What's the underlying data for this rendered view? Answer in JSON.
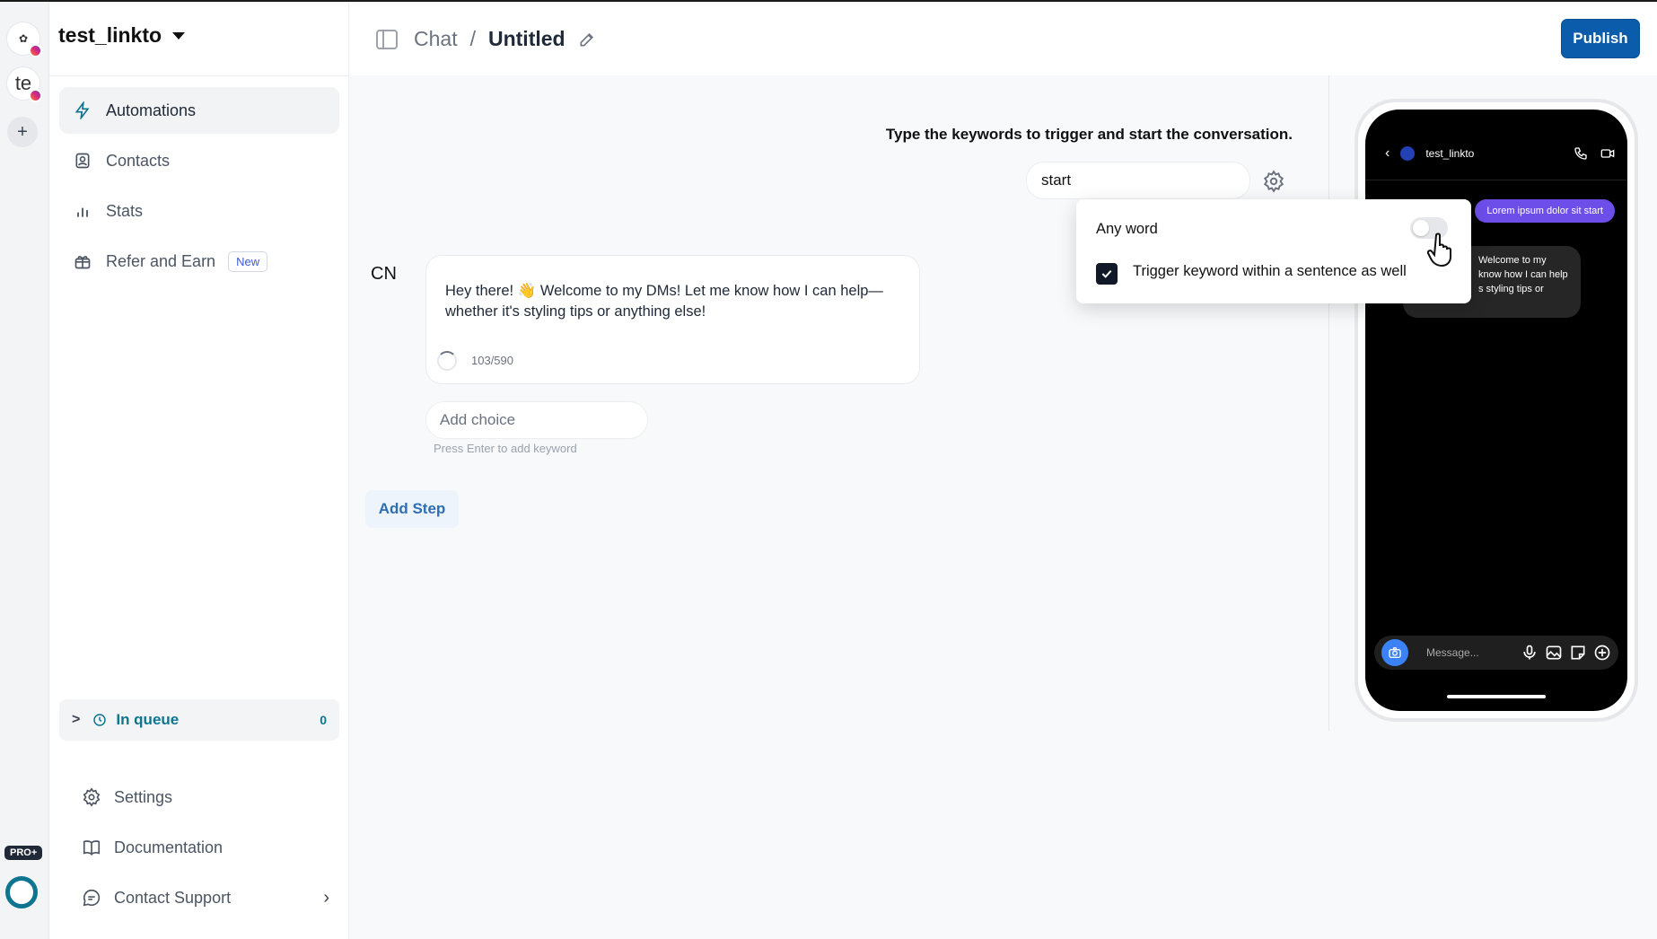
{
  "rail": {
    "add_label": "+",
    "second_account_initials": "te",
    "pro_badge": "PRO+"
  },
  "sidebar": {
    "account_name": "test_linkto",
    "nav": [
      {
        "label": "Automations",
        "icon": "bolt-icon",
        "active": true
      },
      {
        "label": "Contacts",
        "icon": "contact-card-icon"
      },
      {
        "label": "Stats",
        "icon": "bar-chart-icon"
      },
      {
        "label": "Refer and Earn",
        "icon": "gift-icon",
        "badge": "New"
      }
    ],
    "queue": {
      "label": "In queue",
      "count": "0"
    },
    "bottom": [
      {
        "label": "Settings",
        "icon": "gear-icon"
      },
      {
        "label": "Documentation",
        "icon": "book-icon"
      },
      {
        "label": "Contact Support",
        "icon": "support-chat-icon"
      }
    ]
  },
  "header": {
    "crumb_root": "Chat",
    "separator": "/",
    "title": "Untitled",
    "publish_label": "Publish",
    "publish_color": "#0b5cab"
  },
  "canvas": {
    "trigger_instruction": "Type the keywords to trigger and start the conversation.",
    "keyword_value": "start",
    "sender_initials": "CN",
    "message_text": "Hey there! 👋 Welcome to my DMs! Let me know how I can help—whether it's styling tips or anything else!",
    "char_count": "103/590",
    "add_choice_placeholder": "Add choice",
    "press_enter_hint": "Press Enter to add keyword",
    "add_step_label": "Add Step"
  },
  "popover": {
    "any_word_label": "Any word",
    "any_word_enabled": false,
    "sentence_label": "Trigger keyword within a sentence as well",
    "sentence_checked": true
  },
  "phone": {
    "username": "test_linkto",
    "outgoing_bubble": "Lorem ipsum dolor sit start",
    "incoming_bubble": "Welcome to my\nknow how I can help\ns styling tips or",
    "input_placeholder": "Message...",
    "bubble_color": "#6d4ee8"
  }
}
